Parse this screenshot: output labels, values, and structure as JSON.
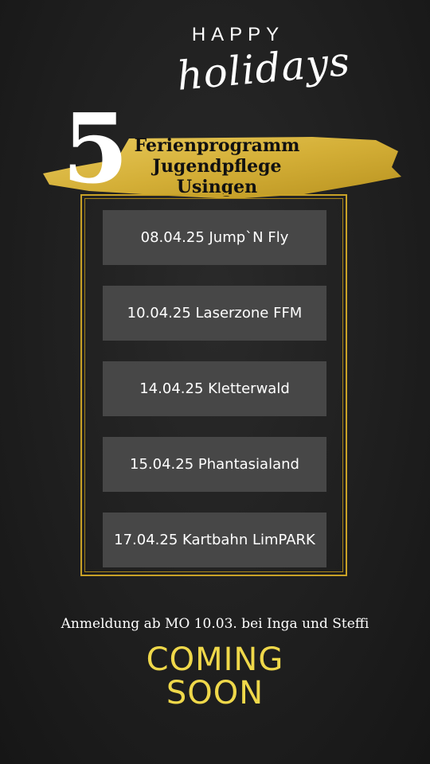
{
  "header": {
    "line1": "HAPPY",
    "line2": "holidays"
  },
  "badge": {
    "number": "5",
    "title_lines": [
      "Ferienprogramm",
      "Jugendpflege",
      "Usingen"
    ]
  },
  "events": [
    {
      "label": "08.04.25 Jump`N Fly"
    },
    {
      "label": "10.04.25 Laserzone FFM"
    },
    {
      "label": "14.04.25 Kletterwald"
    },
    {
      "label": "15.04.25 Phantasialand"
    },
    {
      "label": "17.04.25 Kartbahn LimPARK"
    }
  ],
  "footer": {
    "registration": "Anmeldung ab MO 10.03. bei Inga und Steffi",
    "coming_lines": [
      "COMING",
      "SOON"
    ]
  },
  "colors": {
    "background": "#1e1e1e",
    "gold": "#c9a227",
    "event_box": "#474747",
    "coming_soon": "#efd84a"
  }
}
